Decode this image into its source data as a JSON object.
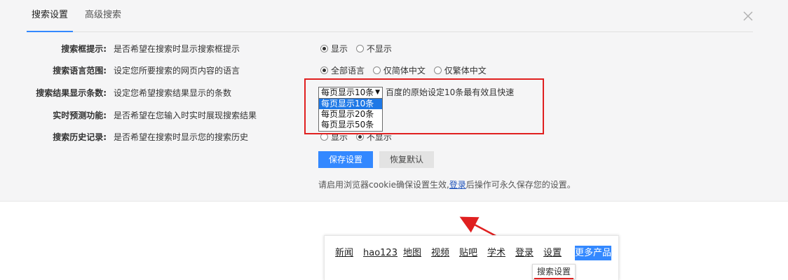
{
  "tabs": [
    {
      "label": "搜索设置",
      "active": true
    },
    {
      "label": "高级搜索",
      "active": false
    }
  ],
  "close_icon": "close-icon",
  "settings": [
    {
      "label": "搜索框提示:",
      "desc": "是否希望在搜索时显示搜索框提示",
      "options": [
        {
          "label": "显示",
          "checked": true
        },
        {
          "label": "不显示",
          "checked": false
        }
      ]
    },
    {
      "label": "搜索语言范围:",
      "desc": "设定您所要搜索的网页内容的语言",
      "options": [
        {
          "label": "全部语言",
          "checked": true
        },
        {
          "label": "仅简体中文",
          "checked": false
        },
        {
          "label": "仅繁体中文",
          "checked": false
        }
      ]
    },
    {
      "label": "搜索结果显示条数:",
      "desc": "设定您希望搜索结果显示的条数",
      "select_value": "每页显示10条",
      "select_options": [
        "每页显示10条",
        "每页显示20条",
        "每页显示50条"
      ],
      "note": "百度的原始设定10条最有效且快速"
    },
    {
      "label": "实时预测功能:",
      "desc": "是否希望在您输入时实时展现搜索结果"
    },
    {
      "label": "搜索历史记录:",
      "desc": "是否希望在搜索时显示您的搜索历史",
      "options": [
        {
          "label": "显示",
          "checked": false
        },
        {
          "label": "不显示",
          "checked": true
        }
      ]
    }
  ],
  "buttons": {
    "save": "保存设置",
    "reset": "恢复默认"
  },
  "tip": {
    "before": "请启用浏览器cookie确保设置生效,",
    "link": "登录",
    "after": "后操作可永久保存您的设置。"
  },
  "nav": {
    "links": [
      "新闻",
      "hao123",
      "地图",
      "视频",
      "贴吧",
      "学术",
      "登录",
      "设置"
    ],
    "more": "更多产品",
    "popup": "搜索设置"
  },
  "colors": {
    "accent": "#3388ff",
    "highlight": "#e02020",
    "panel_bg": "#f5f5f6"
  }
}
